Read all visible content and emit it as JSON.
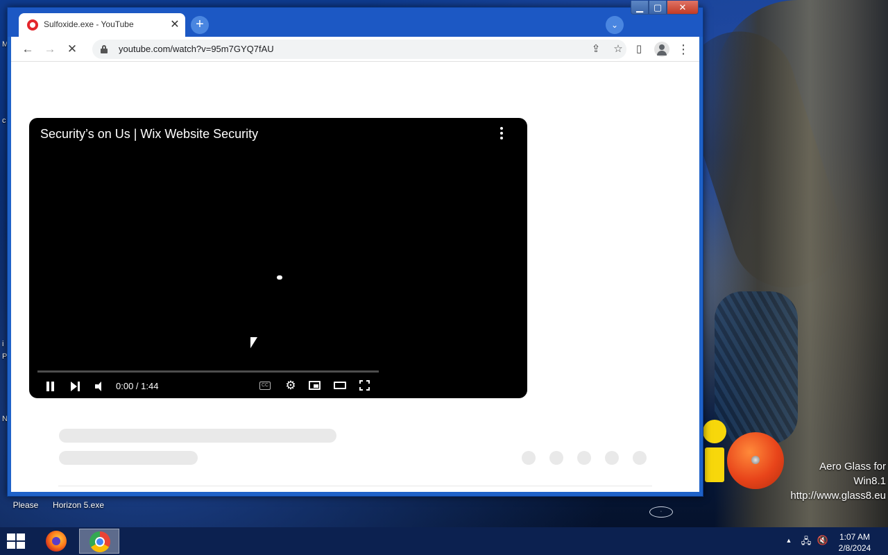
{
  "desktop": {
    "icons": [
      {
        "label_lines": [
          "Please"
        ]
      },
      {
        "label_lines": [
          "Horizon 5.exe"
        ]
      }
    ],
    "watermark": {
      "line1": "Aero Glass for Win8.1",
      "line2": "http://www.glass8.eu"
    },
    "side_letters": [
      "M",
      "c",
      "i",
      "P",
      "N"
    ]
  },
  "browser": {
    "tab": {
      "title": "Sulfoxide.exe - YouTube",
      "favicon": "youtube-icon",
      "close_glyph": "✕"
    },
    "new_tab_glyph": "+",
    "tab_search_glyph": "⌄",
    "window_buttons": {
      "minimize": "▁",
      "maximize": "▢",
      "close": "✕"
    },
    "toolbar": {
      "back_glyph": "←",
      "forward_glyph": "→",
      "stop_glyph": "✕",
      "url": "youtube.com/watch?v=95m7GYQ7fAU",
      "share_glyph": "⇪",
      "bookmark_glyph": "☆",
      "sidepanel_glyph": "▯",
      "menu_glyph": "⋮"
    }
  },
  "player": {
    "title": "Security’s on Us | Wix Website Security",
    "time": "0:00 / 1:44",
    "state": "playing",
    "progress_fraction": 0.0,
    "cc_glyph": "CC",
    "settings_glyph": "⚙"
  },
  "skeleton": {
    "action_placeholders": 5
  },
  "taskbar": {
    "apps": [
      "firefox-icon",
      "chrome-icon"
    ],
    "active_app": "chrome-icon",
    "tray": {
      "up_arrow": "▲",
      "network": "🖧",
      "volume_muted": "🔇"
    },
    "time": "1:07 AM",
    "date": "2/8/2024"
  },
  "colors": {
    "accent": "#1c58c4",
    "youtube_red": "#e3262c",
    "player_bg": "#000000",
    "skeleton": "#e9e9e9"
  }
}
